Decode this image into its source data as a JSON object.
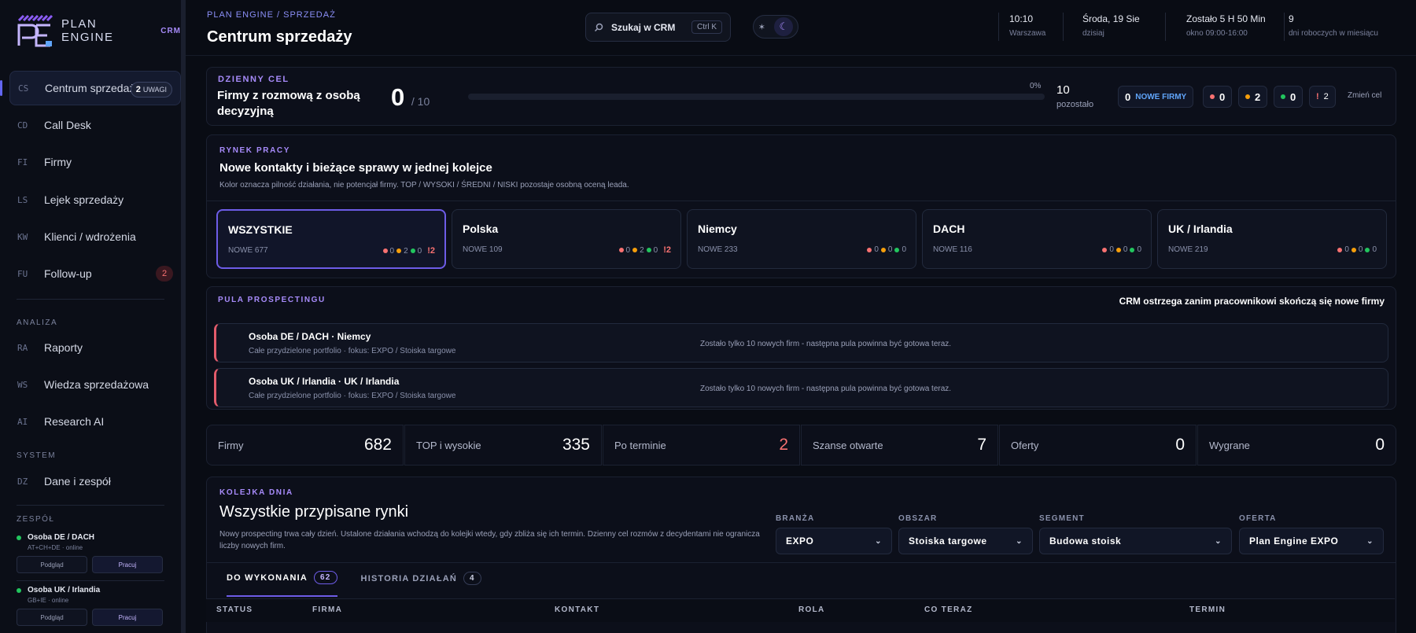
{
  "brand": {
    "name": "PLAN ENGINE",
    "sub": "CRM",
    "colors": {
      "accent": "#6d5ce7",
      "danger": "#f87171",
      "success": "#22c55e",
      "warning": "#f59e0b"
    }
  },
  "nav": {
    "items": [
      {
        "code": "CS",
        "label": "Centrum sprzedaży",
        "badge_count": "2",
        "badge_text": "UWAGI"
      },
      {
        "code": "CD",
        "label": "Call Desk"
      },
      {
        "code": "FI",
        "label": "Firmy"
      },
      {
        "code": "LS",
        "label": "Lejek sprzedaży"
      },
      {
        "code": "KW",
        "label": "Klienci / wdrożenia"
      },
      {
        "code": "FU",
        "label": "Follow-up",
        "count": "2"
      }
    ],
    "analysis_title": "ANALIZA",
    "analysis": [
      {
        "code": "RA",
        "label": "Raporty"
      },
      {
        "code": "WS",
        "label": "Wiedza sprzedażowa"
      },
      {
        "code": "AI",
        "label": "Research AI"
      }
    ],
    "system_title": "SYSTEM",
    "system": [
      {
        "code": "DZ",
        "label": "Dane i zespół"
      }
    ],
    "team_title": "ZESPÓŁ",
    "team": [
      {
        "name": "Osoba DE / DACH",
        "sub": "AT+CH+DE · online",
        "btn_preview": "Podgląd",
        "btn_work": "Pracuj"
      },
      {
        "name": "Osoba UK / Irlandia",
        "sub": "GB+IE · online",
        "btn_preview": "Podgląd",
        "btn_work": "Pracuj"
      }
    ]
  },
  "header": {
    "breadcrumb": "PLAN ENGINE / SPRZEDAŻ",
    "title": "Centrum sprzedaży",
    "search_label": "Szukaj w CRM",
    "search_kbd": "Ctrl K",
    "time": "10:10",
    "time_sub": "Warszawa",
    "date": "Środa, 19 Sie",
    "date_sub": "dzisiaj",
    "left": "Zostało 5 H 50 Min",
    "left_sub": "okno 09:00-16:00",
    "workdays": "9",
    "workdays_sub": "dni roboczych w miesiącu"
  },
  "goal": {
    "kicker": "DZIENNY CEL",
    "title": "Firmy z rozmową z osobą decyzyjną",
    "value": "0",
    "max": "/ 10",
    "progress": 0,
    "progress_label": "0%",
    "remaining": "10",
    "remaining_label": "pozostało",
    "new_count": "0",
    "new_label": "NOWE FIRMY",
    "red": "0",
    "amber": "2",
    "green": "0",
    "alert": "2",
    "change": "Zmień cel"
  },
  "market": {
    "kicker": "RYNEK PRACY",
    "title": "Nowe kontakty i bieżące sprawy w jednej kolejce",
    "subtitle": "Kolor oznacza pilność działania, nie potencjał firmy. TOP / WYSOKI / ŚREDNI / NISKI pozostaje osobną oceną leada.",
    "tiles": [
      {
        "name": "WSZYSTKIE",
        "new": "NOWE 677",
        "r": "0",
        "a": "2",
        "g": "0",
        "flag": "!2"
      },
      {
        "name": "Polska",
        "new": "NOWE 109",
        "r": "0",
        "a": "2",
        "g": "0",
        "flag": "!2"
      },
      {
        "name": "Niemcy",
        "new": "NOWE 233",
        "r": "0",
        "a": "0",
        "g": "0",
        "flag": ""
      },
      {
        "name": "DACH",
        "new": "NOWE 116",
        "r": "0",
        "a": "0",
        "g": "0",
        "flag": ""
      },
      {
        "name": "UK / Irlandia",
        "new": "NOWE 219",
        "r": "0",
        "a": "0",
        "g": "0",
        "flag": ""
      }
    ]
  },
  "pool": {
    "kicker": "PULA PROSPECTINGU",
    "warning": "CRM ostrzega zanim pracownikowi skończą się nowe firmy",
    "rows": [
      {
        "name": "Osoba DE / DACH · Niemcy",
        "sub": "Całe przydzielone portfolio · fokus: EXPO / Stoiska targowe",
        "msg": "Zostało tylko 10 nowych firm - następna pula powinna być gotowa teraz."
      },
      {
        "name": "Osoba UK / Irlandia · UK / Irlandia",
        "sub": "Całe przydzielone portfolio · fokus: EXPO / Stoiska targowe",
        "msg": "Zostało tylko 10 nowych firm - następna pula powinna być gotowa teraz."
      }
    ]
  },
  "stats": [
    {
      "label": "Firmy",
      "value": "682"
    },
    {
      "label": "TOP i wysokie",
      "value": "335"
    },
    {
      "label": "Po terminie",
      "value": "2"
    },
    {
      "label": "Szanse otwarte",
      "value": "7"
    },
    {
      "label": "Oferty",
      "value": "0"
    },
    {
      "label": "Wygrane",
      "value": "0"
    }
  ],
  "queue": {
    "kicker": "KOLEJKA DNIA",
    "title": "Wszystkie przypisane rynki",
    "subtitle": "Nowy prospecting trwa cały dzień. Ustalone działania wchodzą do kolejki wtedy, gdy zbliża się ich termin. Dzienny cel rozmów z decydentami nie ogranicza liczby nowych firm.",
    "filters": [
      {
        "label": "BRANŻA",
        "value": "EXPO"
      },
      {
        "label": "OBSZAR",
        "value": "Stoiska targowe"
      },
      {
        "label": "SEGMENT",
        "value": "Budowa stoisk"
      },
      {
        "label": "OFERTA",
        "value": "Plan Engine EXPO"
      }
    ],
    "tabs": [
      {
        "label": "DO WYKONANIA",
        "count": "62"
      },
      {
        "label": "HISTORIA DZIAŁAŃ",
        "count": "4"
      }
    ],
    "columns": [
      "STATUS",
      "FIRMA",
      "KONTAKT",
      "ROLA",
      "CO TERAZ",
      "TERMIN"
    ]
  }
}
